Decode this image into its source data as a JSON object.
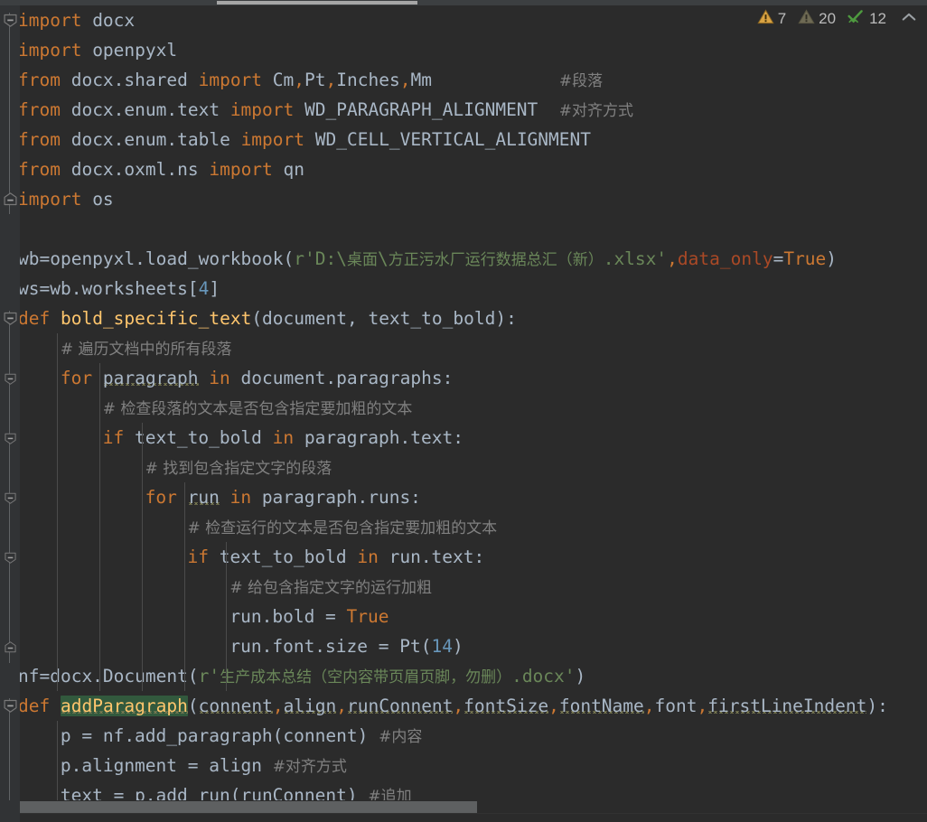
{
  "app": {
    "kind": "code-editor",
    "language": "Python",
    "theme": "Darcula",
    "background": "#2B2B2B",
    "gutter_background": "#313335"
  },
  "colors": {
    "keyword": "#CC7832",
    "identifier": "#A9B7C6",
    "number": "#6897BB",
    "string": "#6A8759",
    "comment": "#808080",
    "function": "#FFC66D",
    "keyword_argument": "#AA4926",
    "caret_highlight": "#32593D",
    "warning_yellow": "#D9A343",
    "weak_warning_gray": "#7C7C64",
    "ok_green": "#5A9E4B",
    "indent_guide": "#4B4B4B",
    "scrollbar_thumb": "#5E6061"
  },
  "inspections": {
    "error_icon": "warning-triangle-yellow-icon",
    "error_count": "7",
    "weak_icon": "warning-triangle-gray-icon",
    "weak_count": "20",
    "ok_icon": "green-double-check-icon",
    "ok_count": "12",
    "collapse_icon": "chevron-up-icon"
  },
  "scrollbars": {
    "horizontal_thumb_label": "horizontal-scrollbar-thumb",
    "top_thumb_label": "top-scrollbar-thumb"
  },
  "code": {
    "lines": [
      {
        "n": 1,
        "indent": 0,
        "fold": "collapse",
        "tokens": [
          {
            "t": "import",
            "c": "kw"
          },
          {
            "t": " docx",
            "c": "id"
          }
        ]
      },
      {
        "n": 2,
        "indent": 0,
        "fold": "",
        "tokens": [
          {
            "t": "import",
            "c": "kw"
          },
          {
            "t": " openpyxl",
            "c": "id"
          }
        ]
      },
      {
        "n": 3,
        "indent": 0,
        "fold": "",
        "tokens": [
          {
            "t": "from",
            "c": "kw"
          },
          {
            "t": " docx.shared ",
            "c": "id"
          },
          {
            "t": "import",
            "c": "kw"
          },
          {
            "t": " Cm",
            "c": "id"
          },
          {
            "t": ",",
            "c": "kw"
          },
          {
            "t": "Pt",
            "c": "id"
          },
          {
            "t": ",",
            "c": "kw"
          },
          {
            "t": "Inches",
            "c": "id"
          },
          {
            "t": ",",
            "c": "kw"
          },
          {
            "t": "Mm",
            "c": "id"
          },
          {
            "t": "            ",
            "c": "id"
          },
          {
            "t": "#段落",
            "c": "cmt",
            "cjk": true
          }
        ]
      },
      {
        "n": 4,
        "indent": 0,
        "fold": "",
        "tokens": [
          {
            "t": "from",
            "c": "kw"
          },
          {
            "t": " docx.enum.text ",
            "c": "id"
          },
          {
            "t": "import",
            "c": "kw"
          },
          {
            "t": " WD_PARAGRAPH_ALIGNMENT  ",
            "c": "id"
          },
          {
            "t": "#对齐方式",
            "c": "cmt",
            "cjk": true
          }
        ]
      },
      {
        "n": 5,
        "indent": 0,
        "fold": "",
        "tokens": [
          {
            "t": "from",
            "c": "kw"
          },
          {
            "t": " docx.enum.table ",
            "c": "id"
          },
          {
            "t": "import",
            "c": "kw"
          },
          {
            "t": " WD_CELL_VERTICAL_ALIGNMENT",
            "c": "id"
          }
        ]
      },
      {
        "n": 6,
        "indent": 0,
        "fold": "",
        "tokens": [
          {
            "t": "from",
            "c": "kw"
          },
          {
            "t": " docx.oxml.ns ",
            "c": "id"
          },
          {
            "t": "import",
            "c": "kw"
          },
          {
            "t": " qn",
            "c": "id"
          }
        ]
      },
      {
        "n": 7,
        "indent": 0,
        "fold": "expand-end",
        "tokens": [
          {
            "t": "import",
            "c": "kw"
          },
          {
            "t": " os",
            "c": "id"
          }
        ]
      },
      {
        "n": 8,
        "indent": 0,
        "fold": "",
        "tokens": []
      },
      {
        "n": 9,
        "indent": 0,
        "fold": "",
        "tokens": [
          {
            "t": "wb=openpyxl.load_workbook(",
            "c": "id"
          },
          {
            "t": "r'D:\\",
            "c": "str"
          },
          {
            "t": "桌面",
            "c": "str",
            "cjk": true
          },
          {
            "t": "\\",
            "c": "str"
          },
          {
            "t": "方正污水厂运行数据总汇（新）",
            "c": "str",
            "cjk": true
          },
          {
            "t": ".xlsx'",
            "c": "str"
          },
          {
            "t": ",",
            "c": "kw"
          },
          {
            "t": "data_only",
            "c": "kwarg"
          },
          {
            "t": "=",
            "c": "id"
          },
          {
            "t": "True",
            "c": "kw"
          },
          {
            "t": ")",
            "c": "id"
          }
        ]
      },
      {
        "n": 10,
        "indent": 0,
        "fold": "",
        "tokens": [
          {
            "t": "ws=wb.worksheets[",
            "c": "id"
          },
          {
            "t": "4",
            "c": "num"
          },
          {
            "t": "]",
            "c": "id"
          }
        ]
      },
      {
        "n": 11,
        "indent": 0,
        "fold": "collapse",
        "tokens": [
          {
            "t": "def",
            "c": "kw"
          },
          {
            "t": " ",
            "c": "id"
          },
          {
            "t": "bold_specific_text",
            "c": "fn"
          },
          {
            "t": "(document, text_to_bold):",
            "c": "id"
          }
        ]
      },
      {
        "n": 12,
        "indent": 1,
        "fold": "",
        "tokens": [
          {
            "t": "# 遍历文档中的所有段落",
            "c": "cmt",
            "cjk": true
          }
        ]
      },
      {
        "n": 13,
        "indent": 1,
        "fold": "collapse-sm",
        "tokens": [
          {
            "t": "for",
            "c": "kw"
          },
          {
            "t": " ",
            "c": "id"
          },
          {
            "t": "paragraph",
            "c": "id",
            "sq": true
          },
          {
            "t": " ",
            "c": "id"
          },
          {
            "t": "in",
            "c": "kw"
          },
          {
            "t": " document.paragraphs:",
            "c": "id"
          }
        ]
      },
      {
        "n": 14,
        "indent": 2,
        "fold": "",
        "tokens": [
          {
            "t": "# 检查段落的文本是否包含指定要加粗的文本",
            "c": "cmt",
            "cjk": true
          }
        ]
      },
      {
        "n": 15,
        "indent": 2,
        "fold": "collapse-sm",
        "tokens": [
          {
            "t": "if",
            "c": "kw"
          },
          {
            "t": " text_to_bold ",
            "c": "id"
          },
          {
            "t": "in",
            "c": "kw"
          },
          {
            "t": " paragraph.text:",
            "c": "id"
          }
        ]
      },
      {
        "n": 16,
        "indent": 3,
        "fold": "",
        "tokens": [
          {
            "t": "# 找到包含指定文字的段落",
            "c": "cmt",
            "cjk": true
          }
        ]
      },
      {
        "n": 17,
        "indent": 3,
        "fold": "collapse-sm",
        "tokens": [
          {
            "t": "for",
            "c": "kw"
          },
          {
            "t": " ",
            "c": "id"
          },
          {
            "t": "run",
            "c": "id",
            "sq": true
          },
          {
            "t": " ",
            "c": "id"
          },
          {
            "t": "in",
            "c": "kw"
          },
          {
            "t": " paragraph.runs:",
            "c": "id"
          }
        ]
      },
      {
        "n": 18,
        "indent": 4,
        "fold": "",
        "tokens": [
          {
            "t": "# 检查运行的文本是否包含指定要加粗的文本",
            "c": "cmt",
            "cjk": true
          }
        ]
      },
      {
        "n": 19,
        "indent": 4,
        "fold": "collapse-sm",
        "tokens": [
          {
            "t": "if",
            "c": "kw"
          },
          {
            "t": " text_to_bold ",
            "c": "id"
          },
          {
            "t": "in",
            "c": "kw"
          },
          {
            "t": " run.text:",
            "c": "id"
          }
        ]
      },
      {
        "n": 20,
        "indent": 5,
        "fold": "",
        "tokens": [
          {
            "t": "# 给包含指定文字的运行加粗",
            "c": "cmt",
            "cjk": true
          }
        ]
      },
      {
        "n": 21,
        "indent": 5,
        "fold": "",
        "tokens": [
          {
            "t": "run.bold = ",
            "c": "id"
          },
          {
            "t": "True",
            "c": "kw"
          }
        ]
      },
      {
        "n": 22,
        "indent": 5,
        "fold": "expand-end-sm",
        "tokens": [
          {
            "t": "run.font.size = Pt(",
            "c": "id"
          },
          {
            "t": "14",
            "c": "num"
          },
          {
            "t": ")",
            "c": "id"
          }
        ]
      },
      {
        "n": 23,
        "indent": 0,
        "fold": "",
        "tokens": [
          {
            "t": "nf=docx.Document(",
            "c": "id"
          },
          {
            "t": "r'",
            "c": "str"
          },
          {
            "t": "生产成本总结（空内容带页眉页脚，勿删）",
            "c": "str",
            "cjk": true
          },
          {
            "t": ".docx'",
            "c": "str"
          },
          {
            "t": ")",
            "c": "id"
          }
        ]
      },
      {
        "n": 24,
        "indent": 0,
        "fold": "collapse",
        "tokens": [
          {
            "t": "def",
            "c": "kw"
          },
          {
            "t": " ",
            "c": "id"
          },
          {
            "t": "addParagraph",
            "c": "fn",
            "hl": true,
            "sq": true
          },
          {
            "t": "(",
            "c": "id"
          },
          {
            "t": "connent",
            "c": "id",
            "sq": true
          },
          {
            "t": ",",
            "c": "kw"
          },
          {
            "t": "align",
            "c": "id",
            "sq": true
          },
          {
            "t": ",",
            "c": "kw"
          },
          {
            "t": "runConnent",
            "c": "id",
            "sq": true
          },
          {
            "t": ",",
            "c": "kw"
          },
          {
            "t": "fontSize",
            "c": "id",
            "sq": true
          },
          {
            "t": ",",
            "c": "kw"
          },
          {
            "t": "fontName",
            "c": "id",
            "sq": true
          },
          {
            "t": ",",
            "c": "kw"
          },
          {
            "t": "font",
            "c": "id"
          },
          {
            "t": ",",
            "c": "kw"
          },
          {
            "t": "firstLineIndent",
            "c": "id",
            "sq": true
          },
          {
            "t": "):",
            "c": "id"
          }
        ]
      },
      {
        "n": 25,
        "indent": 1,
        "fold": "",
        "tokens": [
          {
            "t": "p = nf.add_paragraph(connent) ",
            "c": "id"
          },
          {
            "t": "#内容",
            "c": "cmt",
            "cjk": true
          }
        ]
      },
      {
        "n": 26,
        "indent": 1,
        "fold": "",
        "tokens": [
          {
            "t": "p.alignment = align ",
            "c": "id"
          },
          {
            "t": "#对齐方式",
            "c": "cmt",
            "cjk": true
          }
        ]
      },
      {
        "n": 27,
        "indent": 1,
        "fold": "",
        "tokens": [
          {
            "t": "text",
            "c": "id",
            "sq": true
          },
          {
            "t": " = p.add_run(runConnent) ",
            "c": "id"
          },
          {
            "t": "#追加",
            "c": "cmt",
            "cjk": true
          }
        ]
      }
    ]
  }
}
